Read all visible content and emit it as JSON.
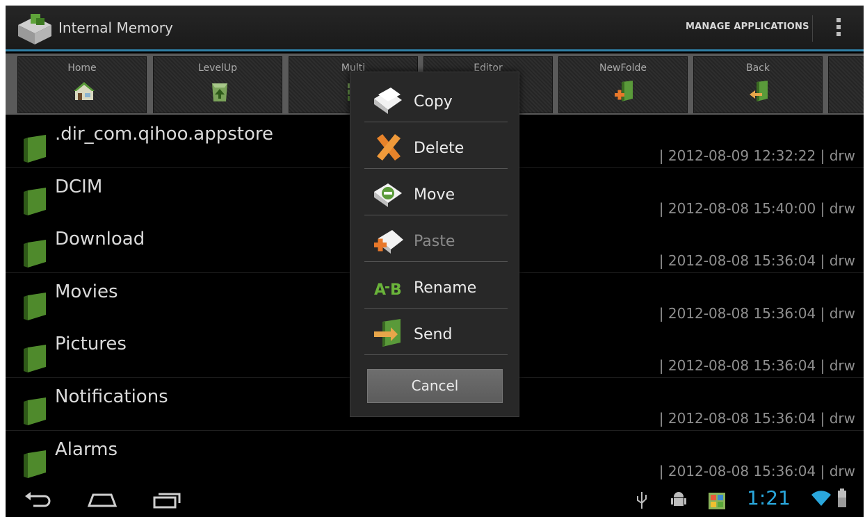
{
  "app": {
    "title": "Internal Memory",
    "manage_applications": "MANAGE APPLICATIONS"
  },
  "toolbar": [
    {
      "label": "Home",
      "icon": "home-icon"
    },
    {
      "label": "LevelUp",
      "icon": "level-up-icon"
    },
    {
      "label": "Multi",
      "icon": "multi-icon"
    },
    {
      "label": "Editor",
      "icon": "editor-icon"
    },
    {
      "label": "NewFolde",
      "icon": "new-folder-icon"
    },
    {
      "label": "Back",
      "icon": "back-icon"
    }
  ],
  "files": [
    {
      "name": ".dir_com.qihoo.appstore",
      "meta": "| 2012-08-09 12:32:22 | drw"
    },
    {
      "name": "DCIM",
      "meta": "| 2012-08-08 15:40:00 | drw"
    },
    {
      "name": "Download",
      "meta": "| 2012-08-08 15:36:04 | drw"
    },
    {
      "name": "Movies",
      "meta": "| 2012-08-08 15:36:04 | drw"
    },
    {
      "name": "Pictures",
      "meta": "| 2012-08-08 15:36:04 | drw"
    },
    {
      "name": "Notifications",
      "meta": "| 2012-08-08 15:36:04 | drw"
    },
    {
      "name": "Alarms",
      "meta": "| 2012-08-08 15:36:04 | drw"
    }
  ],
  "menu": {
    "items": [
      {
        "label": "Copy",
        "icon": "copy-icon",
        "enabled": true
      },
      {
        "label": "Delete",
        "icon": "delete-icon",
        "enabled": true
      },
      {
        "label": "Move",
        "icon": "move-icon",
        "enabled": true
      },
      {
        "label": "Paste",
        "icon": "paste-icon",
        "enabled": false
      },
      {
        "label": "Rename",
        "icon": "rename-icon",
        "enabled": true
      },
      {
        "label": "Send",
        "icon": "send-icon",
        "enabled": true
      }
    ],
    "cancel": "Cancel"
  },
  "status": {
    "time": "1:21"
  },
  "colors": {
    "accent": "#2f7fa6",
    "clock": "#2aa7dc",
    "folder_green": "#4a8a2a"
  }
}
